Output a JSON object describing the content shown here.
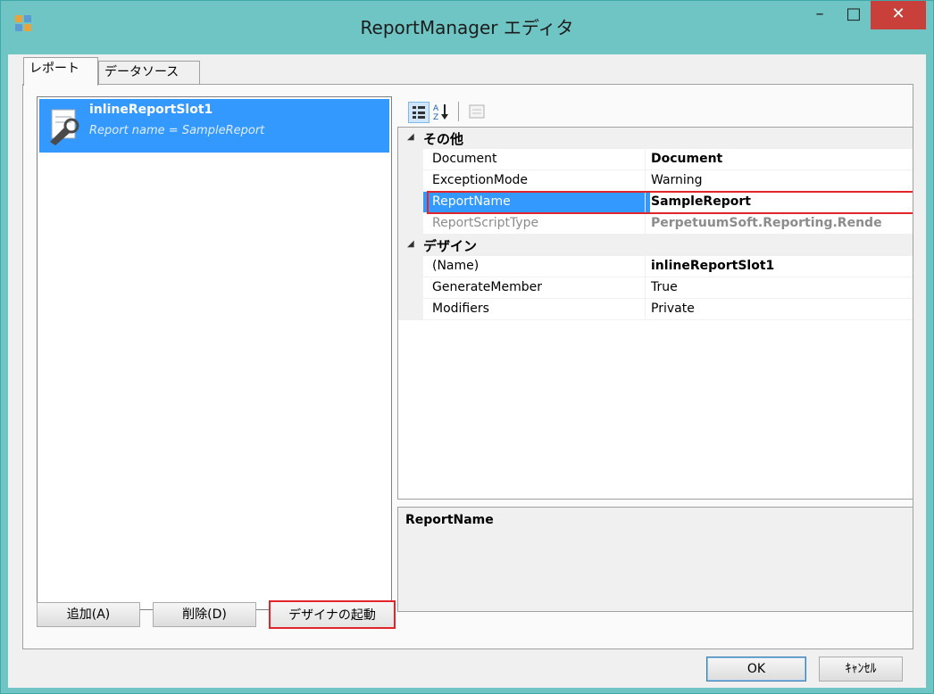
{
  "window": {
    "title": "ReportManager エディタ",
    "minimize": "–",
    "maximize": "□",
    "close": "✕"
  },
  "tabs": [
    {
      "label": "レポート"
    },
    {
      "label": "データソース"
    }
  ],
  "report_list": {
    "items": [
      {
        "title": "inlineReportSlot1",
        "subtitle": "Report name = SampleReport"
      }
    ]
  },
  "property_grid": {
    "categories": [
      {
        "label": "その他",
        "rows": [
          {
            "name": "Document",
            "value": "Document"
          },
          {
            "name": "ExceptionMode",
            "value": "Warning"
          },
          {
            "name": "ReportName",
            "value": "SampleReport"
          },
          {
            "name": "ReportScriptType",
            "value": "PerpetuumSoft.Reporting.Rende"
          }
        ]
      },
      {
        "label": "デザイン",
        "rows": [
          {
            "name": "(Name)",
            "value": "inlineReportSlot1"
          },
          {
            "name": "GenerateMember",
            "value": "True"
          },
          {
            "name": "Modifiers",
            "value": "Private"
          }
        ]
      }
    ],
    "description_title": "ReportName"
  },
  "buttons": {
    "add": "追加(A)",
    "delete": "削除(D)",
    "designer": "デザイナの起動",
    "ok": "OK",
    "cancel": "ｷｬﾝｾﾙ"
  },
  "colors": {
    "titlebar": "#6fc4c4",
    "selection": "#3399ff",
    "highlight_box": "#e2252a",
    "close_button": "#c9403a"
  }
}
